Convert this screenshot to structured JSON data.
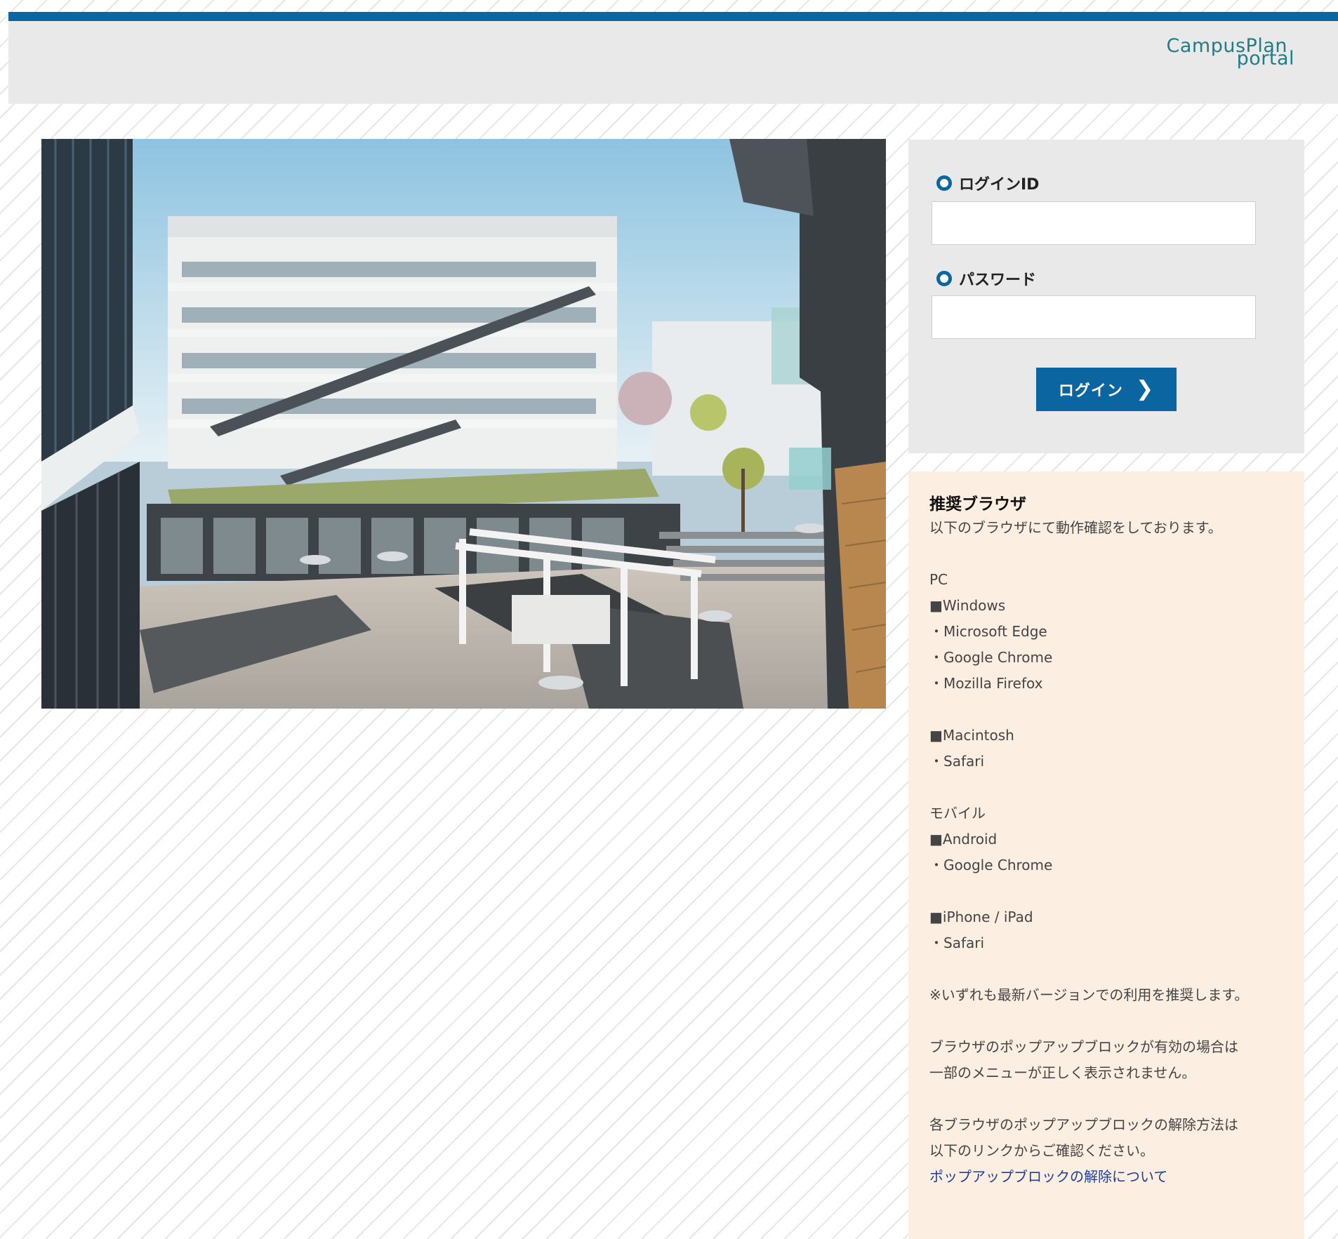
{
  "header": {
    "logo_line1": "CampusPlan",
    "logo_line2": "portal"
  },
  "login": {
    "id_label": "ログインID",
    "id_value": "",
    "password_label": "パスワード",
    "password_value": "",
    "button_label": "ログイン",
    "button_icon": "chevron-right-icon"
  },
  "info": {
    "title": "推奨ブラウザ",
    "subtitle": "以下のブラウザにて動作確認をしております。",
    "pc_heading": "PC",
    "windows_heading": "■Windows",
    "windows_browsers": [
      "・Microsoft Edge",
      "・Google Chrome",
      "・Mozilla Firefox"
    ],
    "mac_heading": "■Macintosh",
    "mac_browsers": [
      "・Safari"
    ],
    "mobile_heading": "モバイル",
    "android_heading": "■Android",
    "android_browsers": [
      "・Google Chrome"
    ],
    "ios_heading": "■iPhone / iPad",
    "ios_browsers": [
      "・Safari"
    ],
    "note_latest": "※いずれも最新バージョンでの利用を推奨します。",
    "popup_note_1": "ブラウザのポップアップブロックが有効の場合は",
    "popup_note_2": "一部のメニューが正しく表示されません。",
    "release_note_1": "各ブラウザのポップアップブロックの解除方法は",
    "release_note_2": "以下のリンクからご確認ください。",
    "link_label": "ポップアップブロックの解除について"
  },
  "colors": {
    "brand_blue": "#0b65a1",
    "logo_teal": "#1f7d86",
    "info_bg": "#fcefe2",
    "panel_bg": "#e9e9e9",
    "link": "#1a3f9a"
  }
}
